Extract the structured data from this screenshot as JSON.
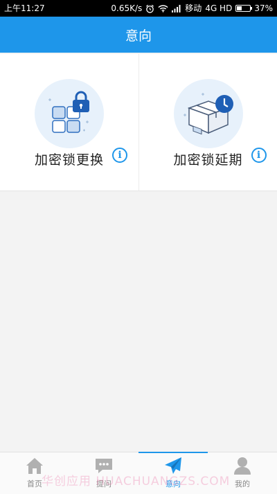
{
  "status_bar": {
    "time": "上午11:27",
    "speed": "0.65K/s",
    "carrier": "移动",
    "network": "4G HD",
    "battery_percent": "37%",
    "battery_level": 0.37
  },
  "header": {
    "title": "意向"
  },
  "cards": [
    {
      "label": "加密锁更换",
      "icon": "lock-blocks-icon"
    },
    {
      "label": "加密锁延期",
      "icon": "box-clock-icon"
    }
  ],
  "tabs": [
    {
      "label": "首页",
      "icon": "home-icon",
      "active": false
    },
    {
      "label": "提问",
      "icon": "chat-bubble-icon",
      "active": false
    },
    {
      "label": "意向",
      "icon": "paper-plane-icon",
      "active": true
    },
    {
      "label": "我的",
      "icon": "user-icon",
      "active": false
    }
  ],
  "watermark": "华创应用 HUACHUANGZS.COM",
  "colors": {
    "primary": "#1e96ea",
    "tab_inactive": "#b0b0b0"
  }
}
